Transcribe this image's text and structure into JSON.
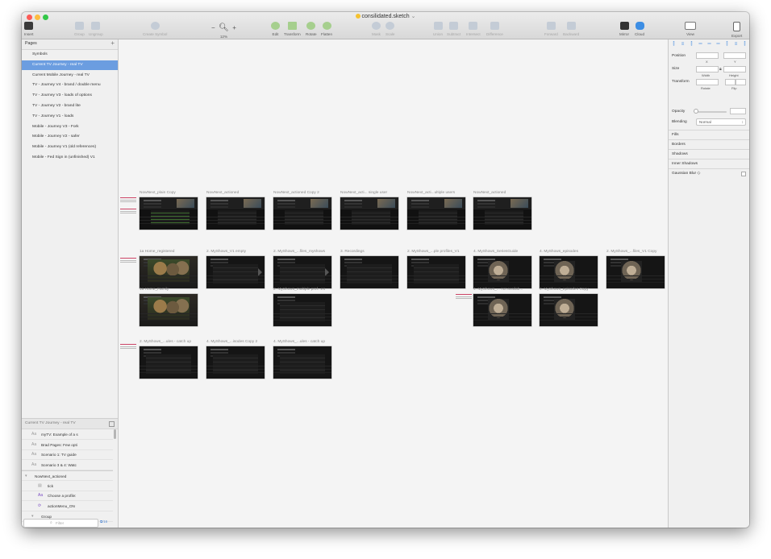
{
  "window": {
    "title": "consilidated.sketch",
    "title_chevron": "⌄",
    "traffic_light_colors": [
      "#fc5b57",
      "#fdbc40",
      "#33c748"
    ]
  },
  "toolbar": {
    "insert": "Insert",
    "group": "Group",
    "ungroup": "Ungroup",
    "create_symbol": "Create Symbol",
    "zoom_minus": "−",
    "zoom_plus": "+",
    "zoom_value": "12%",
    "edit": "Edit",
    "transform": "Transform",
    "rotate": "Rotate",
    "flatten": "Flatten",
    "mask": "Mask",
    "scale": "Scale",
    "union": "Union",
    "subtract": "Subtract",
    "intersect": "Intersect",
    "difference": "Difference",
    "forward": "Forward",
    "backward": "Backward",
    "mirror": "Mirror",
    "cloud": "Cloud",
    "view": "View",
    "export": "Export"
  },
  "pages": {
    "header": "Pages",
    "add": "+",
    "items": [
      "Symbols",
      "Current TV Journey - real TV",
      "Current Mobile Journey - real TV",
      "TV - Journey V4 - brand / double menu",
      "TV - Journey V3 - loads of options",
      "TV - Journey V2 - brand lite",
      "TV - Journey V1 - loads",
      "Mobile - Journey V3 - Fork",
      "Mobile - Journey V2 - safer",
      "Mobile - Journey V1 (old references)",
      "Mobile - Fed Sign in (unfinished) V1"
    ],
    "selected_index": 1
  },
  "layers": {
    "header": "Current TV Journey - real TV",
    "items": [
      {
        "icon": "Aa",
        "label": "myTV: Example of a s"
      },
      {
        "icon": "Aa",
        "label": "Brad Pages: Few opti"
      },
      {
        "icon": "Aa",
        "label": "Scenario 1: TV guide"
      },
      {
        "icon": "Aa",
        "label": "Scenario 3 & 4: Watc"
      },
      {
        "icon": "▾",
        "label": "NowNext_actioned"
      },
      {
        "icon": "▤",
        "label": "tick"
      },
      {
        "icon": "Aa",
        "label": "Choose a profile:"
      },
      {
        "icon": "⟳",
        "label": "actionMenu_ON"
      },
      {
        "icon": "▾",
        "label": "Group"
      }
    ],
    "filter_placeholder": "Filter",
    "filter_count": "16"
  },
  "canvas": {
    "artboards": [
      {
        "label": "NowNext_plain Copy",
        "style": "tv grn"
      },
      {
        "label": "NowNext_actioned",
        "style": "tv"
      },
      {
        "label": "NowNext_actioned Copy 2",
        "style": "tv"
      },
      {
        "label": "NowNext_acti... single user",
        "style": "tv"
      },
      {
        "label": "NowNext_acti...ultiple users",
        "style": "tv"
      },
      {
        "label": "NowNext_actioned",
        "style": "tv"
      },
      {
        "label": "1a Home_registered",
        "style": "photo"
      },
      {
        "label": "2. MyShows_V1 empty",
        "style": "list arrow"
      },
      {
        "label": "2. MyShows_...files_myshows",
        "style": "list arrow"
      },
      {
        "label": "3. Recordings",
        "style": "list"
      },
      {
        "label": "2. MyShows_...ple profiles_V1",
        "style": "list"
      },
      {
        "label": "4. MyShows_SeriesGuide",
        "style": "cat"
      },
      {
        "label": "4. MyShows_episodes",
        "style": "cat"
      },
      {
        "label": "2. MyShows_...files_V1 Copy",
        "style": "cat"
      },
      {
        "label": "1a Home_Family",
        "style": "photo"
      },
      {
        "label": "2. MyShows_multiple prof...es",
        "style": "list"
      },
      {
        "label": "4. MyShows_... not availab...",
        "style": "cat"
      },
      {
        "label": "4. MyShows_episodes Copy",
        "style": "cat"
      },
      {
        "label": "2. MyShows_...ules - catch up",
        "style": "list"
      },
      {
        "label": "4. MyShows_...isodes Copy 2",
        "style": "list"
      },
      {
        "label": "4. MyShows_...ules - catch up",
        "style": "list"
      }
    ]
  },
  "inspector": {
    "position": "Position",
    "x": "X",
    "y": "Y",
    "size": "Size",
    "width": "Width",
    "height": "Height",
    "transform": "Transform",
    "rotate": "Rotate",
    "flip": "Flip",
    "opacity": "Opacity",
    "blending": "Blending",
    "blending_value": "Normal",
    "fills": "Fills",
    "borders": "Borders",
    "shadows": "Shadows",
    "inner_shadows": "Inner Shadows",
    "gaussian_blur": "Gaussian Blur ◇"
  },
  "colors": {
    "selection": "#6b9de0",
    "accent": "#4a8fdf"
  }
}
